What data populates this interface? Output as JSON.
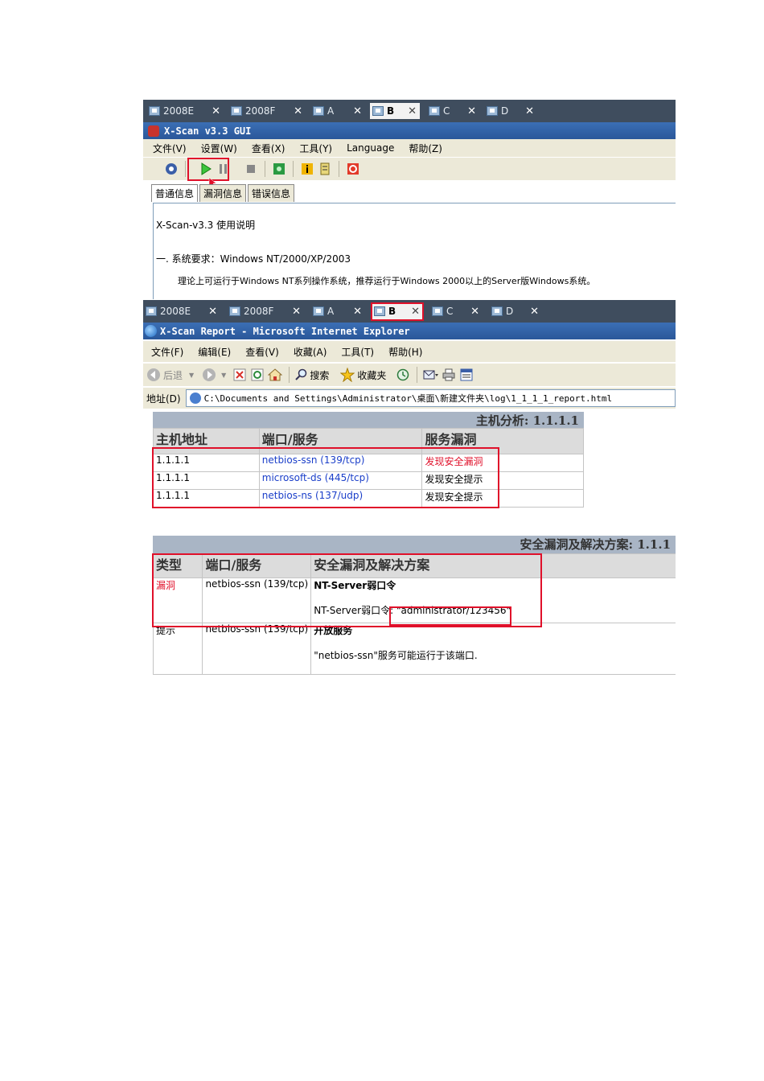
{
  "vm_tabs": [
    {
      "label": "2008E"
    },
    {
      "label": "2008F"
    },
    {
      "label": "A"
    },
    {
      "label": "B",
      "active": true
    },
    {
      "label": "C"
    },
    {
      "label": "D"
    }
  ],
  "xscan": {
    "title": "X-Scan v3.3 GUI",
    "menu": [
      "文件(V)",
      "设置(W)",
      "查看(X)",
      "工具(Y)",
      "Language",
      "帮助(Z)"
    ],
    "tabs": [
      "普通信息",
      "漏洞信息",
      "错误信息"
    ],
    "content_lines": [
      "X-Scan-v3.3 使用说明",
      "一. 系统要求：Windows NT/2000/XP/2003",
      "理论上可运行于Windows NT系列操作系统，推荐运行于Windows 2000以上的Server版Windows系统。"
    ]
  },
  "ie": {
    "title": "X-Scan Report - Microsoft Internet Explorer",
    "menu": [
      "文件(F)",
      "编辑(E)",
      "查看(V)",
      "收藏(A)",
      "工具(T)",
      "帮助(H)"
    ],
    "toolbar": {
      "back": "后退",
      "search": "搜索",
      "favorites": "收藏夹"
    },
    "address_label": "地址(D)",
    "address_url": "C:\\Documents and Settings\\Administrator\\桌面\\新建文件夹\\log\\1_1_1_1_report.html"
  },
  "host_analysis": {
    "title": "主机分析: 1.1.1.1",
    "headers": [
      "主机地址",
      "端口/服务",
      "服务漏洞"
    ],
    "rows": [
      {
        "host": "1.1.1.1",
        "service": "netbios-ssn (139/tcp)",
        "status": "发现安全漏洞",
        "alert": true
      },
      {
        "host": "1.1.1.1",
        "service": "microsoft-ds (445/tcp)",
        "status": "发现安全提示",
        "alert": false
      },
      {
        "host": "1.1.1.1",
        "service": "netbios-ns (137/udp)",
        "status": "发现安全提示",
        "alert": false
      }
    ]
  },
  "vulns": {
    "title": "安全漏洞及解决方案: 1.1.1",
    "headers": [
      "类型",
      "端口/服务",
      "安全漏洞及解决方案"
    ],
    "rows": [
      {
        "type": "漏洞",
        "service": "netbios-ssn (139/tcp)",
        "heading": "NT-Server弱口令",
        "detail_prefix": "NT-Server弱口令:",
        "detail_value": "\"administrator/123456\""
      },
      {
        "type": "提示",
        "service": "netbios-ssn (139/tcp)",
        "heading": "开放服务",
        "detail_prefix": "",
        "detail_value": "\"netbios-ssn\"服务可能运行于该端口."
      }
    ]
  }
}
